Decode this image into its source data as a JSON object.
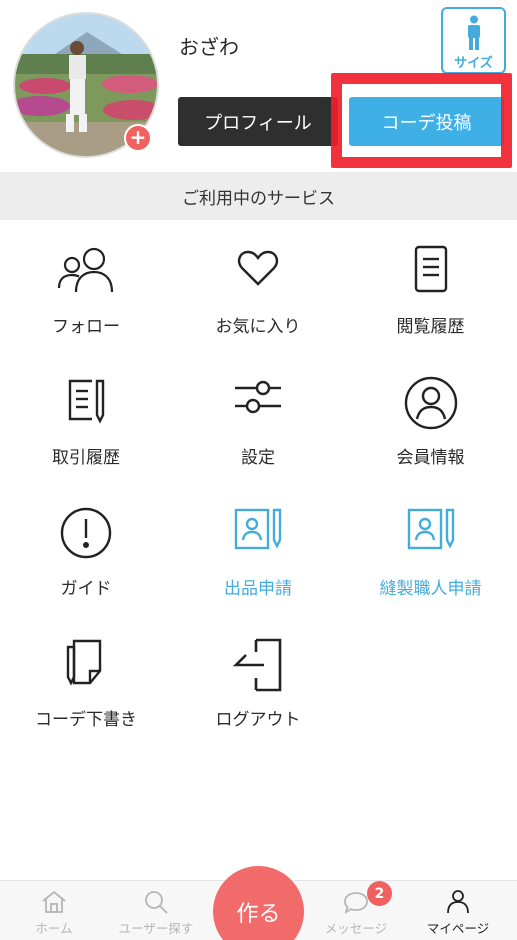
{
  "profile": {
    "username": "おざわ",
    "avatar_icon": "user-photo",
    "add_icon": "plus-icon",
    "add_symbol": "+",
    "size_button_label": "サイズ",
    "profile_button_label": "プロフィール",
    "post_button_label": "コーデ投稿"
  },
  "services": {
    "title": "ご利用中のサービス",
    "items": [
      {
        "label": "フォロー",
        "icon": "users-icon",
        "color": "#222222"
      },
      {
        "label": "お気に入り",
        "icon": "heart-icon",
        "color": "#222222"
      },
      {
        "label": "閲覧履歴",
        "icon": "document-icon",
        "color": "#222222"
      },
      {
        "label": "取引履歴",
        "icon": "document-pen-icon",
        "color": "#222222"
      },
      {
        "label": "設定",
        "icon": "sliders-icon",
        "color": "#222222"
      },
      {
        "label": "会員情報",
        "icon": "user-circle-icon",
        "color": "#222222"
      },
      {
        "label": "ガイド",
        "icon": "exclamation-circle-icon",
        "color": "#222222"
      },
      {
        "label": "出品申請",
        "icon": "id-card-pen-icon",
        "color": "#43acdd"
      },
      {
        "label": "縫製職人申請",
        "icon": "id-card-pen-icon",
        "color": "#43acdd"
      },
      {
        "label": "コーデ下書き",
        "icon": "draft-icon",
        "color": "#222222"
      },
      {
        "label": "ログアウト",
        "icon": "logout-icon",
        "color": "#222222"
      }
    ]
  },
  "tabbar": {
    "home": "ホーム",
    "search_users": "ユーザー探す",
    "create": "作る",
    "messages": "メッセージ",
    "messages_badge": "2",
    "mypage": "マイページ"
  },
  "colors": {
    "accent_blue": "#3fb0e6",
    "create_red": "#f26b6b",
    "highlight_red": "#f0202a",
    "dark_button": "#2f2f2f"
  }
}
